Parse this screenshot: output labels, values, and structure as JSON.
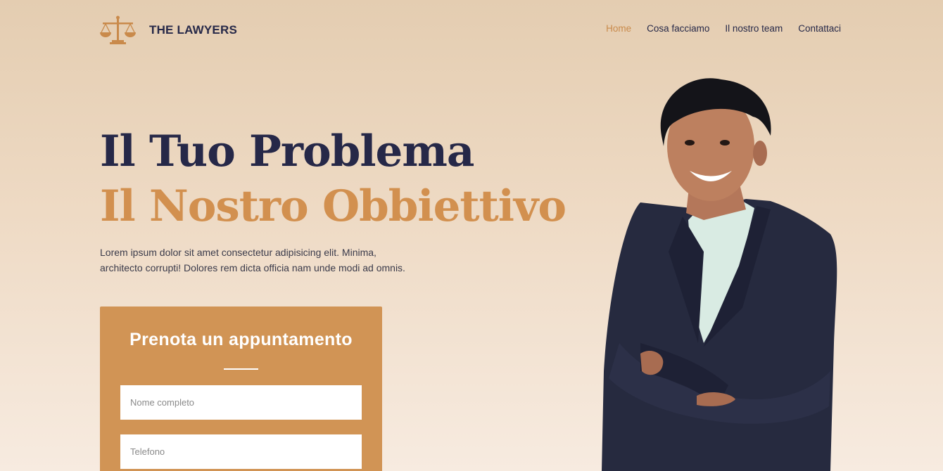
{
  "brand": {
    "name": "THE LAWYERS",
    "logo_icon": "scales-of-justice-icon",
    "accent_color": "#d2904f",
    "dark_color": "#262848"
  },
  "nav": {
    "items": [
      {
        "label": "Home",
        "active": true
      },
      {
        "label": "Cosa facciamo",
        "active": false
      },
      {
        "label": "Il nostro team",
        "active": false
      },
      {
        "label": "Contattaci",
        "active": false
      }
    ]
  },
  "hero": {
    "headline_line1": "Il Tuo Problema",
    "headline_line2": "Il Nostro Obbiettivo",
    "intro_line1": "Lorem ipsum dolor sit amet consectetur adipisicing elit. Minima,",
    "intro_line2": "architecto corrupti! Dolores rem dicta officia nam unde modi ad omnis."
  },
  "booking": {
    "title": "Prenota un appuntamento",
    "name_placeholder": "Nome completo",
    "phone_placeholder": "Telefono",
    "card_color": "#d19455"
  }
}
